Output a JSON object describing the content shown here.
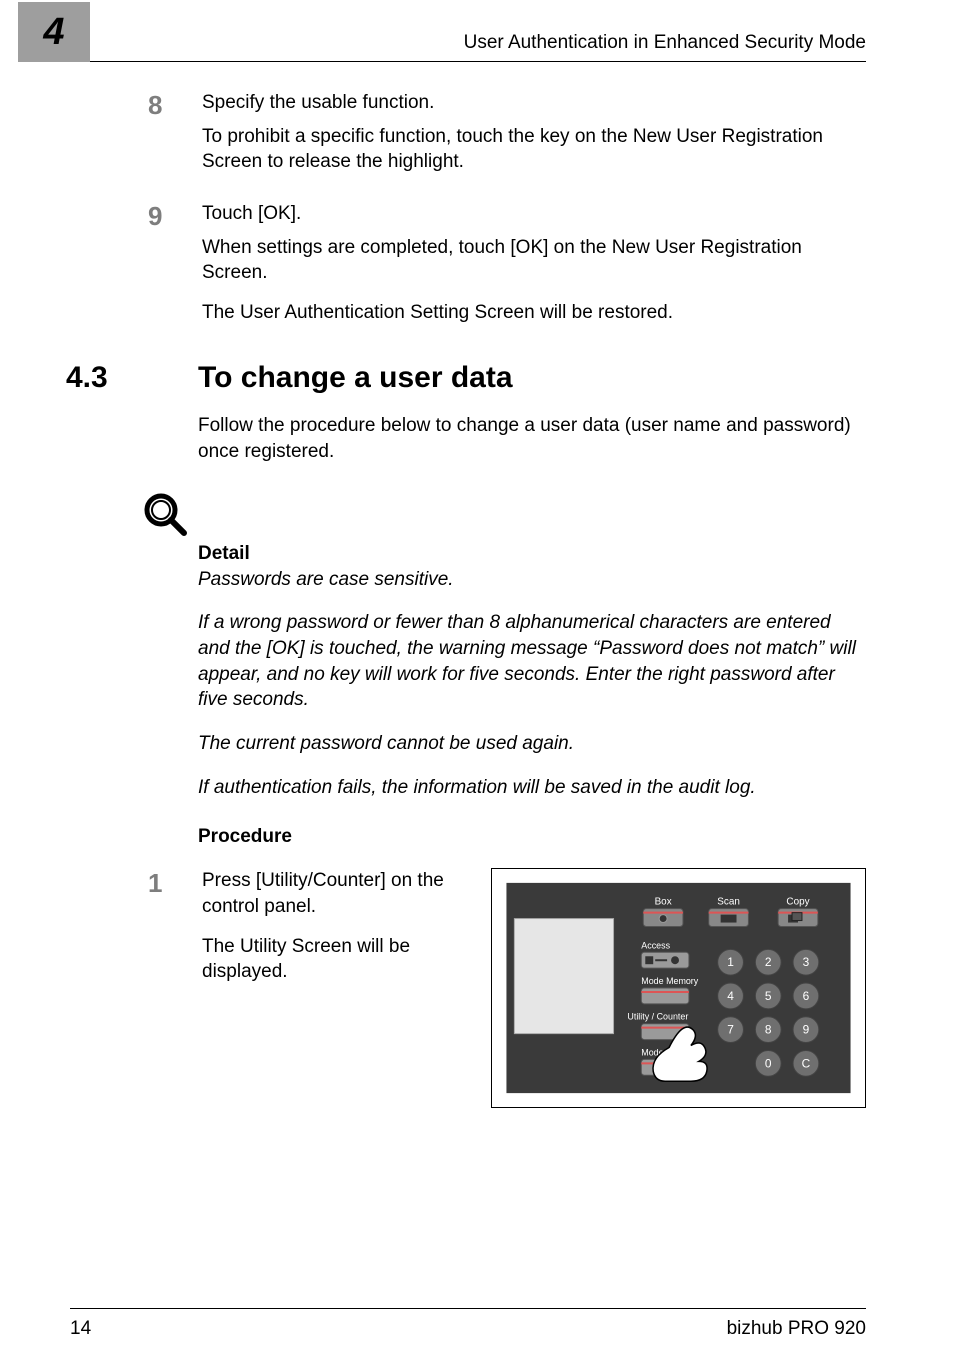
{
  "running_head": "User Authentication in Enhanced Security Mode",
  "chapter_number": "4",
  "step8": {
    "num": "8",
    "line1": "Specify the usable function.",
    "line2": "To prohibit a specific function, touch the key on the New User Registration Screen to release the highlight."
  },
  "step9": {
    "num": "9",
    "line1": "Touch [OK].",
    "line2": "When settings are completed, touch [OK] on the New User Registration Screen.",
    "line3": "The User Authentication Setting Screen will be restored."
  },
  "section": {
    "num": "4.3",
    "title": "To change a user data"
  },
  "section_intro": "Follow the procedure below to change a user data (user name and password) once registered.",
  "detail": {
    "head": "Detail",
    "p1": "Passwords are case sensitive.",
    "p2": "If a wrong password or fewer than 8 alphanumerical characters are entered and the [OK] is touched, the warning message “Password does not match” will appear, and no key will work for five seconds. Enter the right password after five seconds.",
    "p3": "The current password cannot be used again.",
    "p4": "If authentication fails, the information will be saved in the audit log."
  },
  "procedure_head": "Procedure",
  "step1": {
    "num": "1",
    "line1": "Press [Utility/Counter] on the control panel.",
    "line2": "The Utility Screen will be displayed."
  },
  "panel": {
    "box": "Box",
    "scan": "Scan",
    "copy": "Copy",
    "access": "Access",
    "mode_memory": "Mode Memory",
    "utility_counter": "Utility / Counter",
    "mode_c": "Mode C",
    "keys": [
      "1",
      "2",
      "3",
      "4",
      "5",
      "6",
      "7",
      "8",
      "9",
      "0",
      "C"
    ]
  },
  "footer": {
    "page": "14",
    "model": "bizhub PRO 920"
  }
}
